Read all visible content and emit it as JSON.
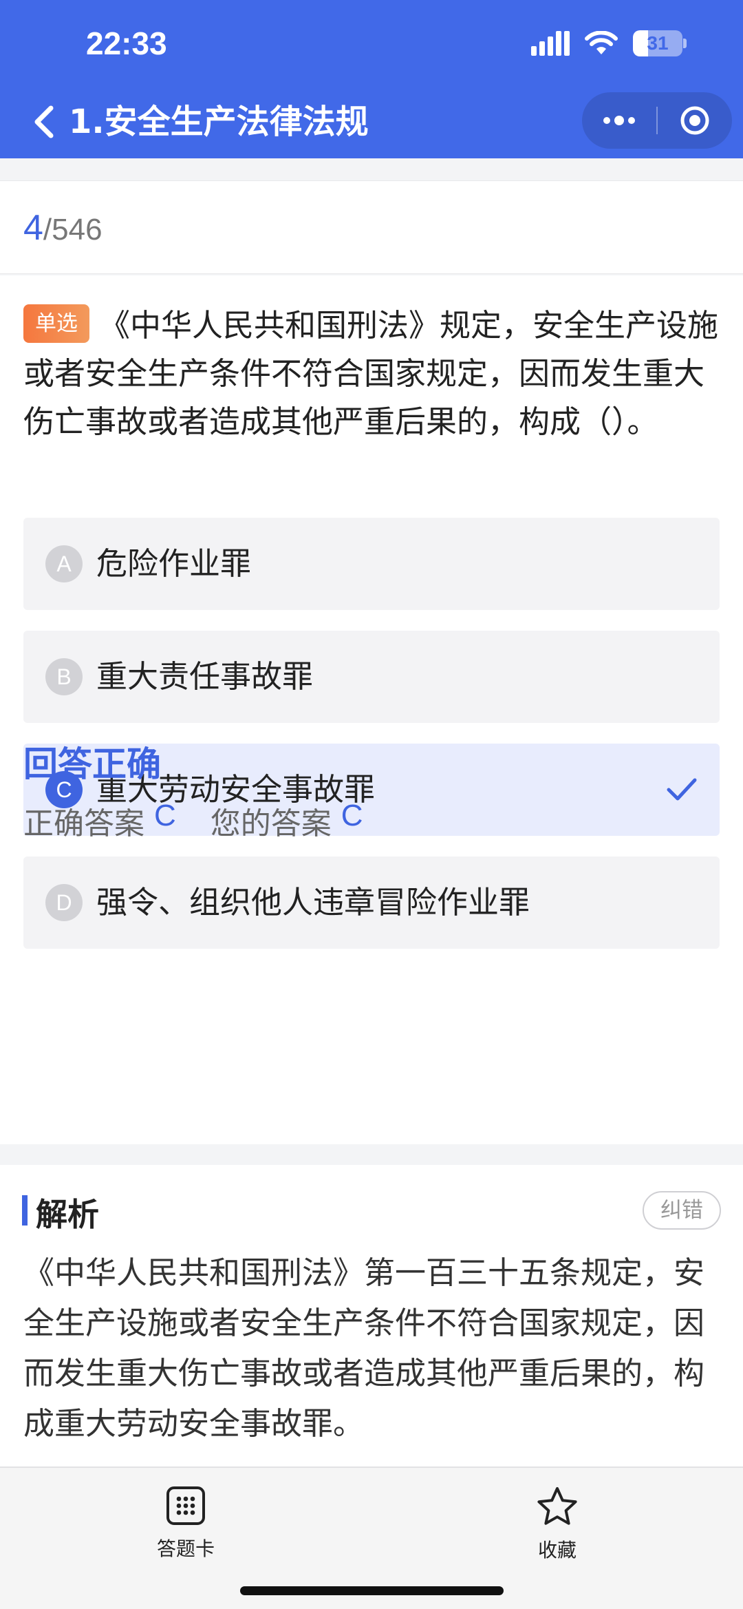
{
  "status_bar": {
    "time": "22:33",
    "battery": "31",
    "battery_level": 0.31
  },
  "nav": {
    "title": "1.安全生产法律法规",
    "back_icon": "chevron-left-icon",
    "more_icon": "more-dots-icon",
    "close_icon": "target-circle-icon"
  },
  "progress": {
    "current": "4",
    "total": "/546"
  },
  "question": {
    "type_badge": "单选",
    "text": "《中华人民共和国刑法》规定，安全生产设施或者安全生产条件不符合国家规定，因而发生重大伤亡事故或者造成其他严重后果的，构成（）。",
    "options": [
      {
        "letter": "A",
        "text": "危险作业罪",
        "selected": false
      },
      {
        "letter": "B",
        "text": "重大责任事故罪",
        "selected": false
      },
      {
        "letter": "C",
        "text": "重大劳动安全事故罪",
        "selected": true
      },
      {
        "letter": "D",
        "text": "强令、组织他人违章冒险作业罪",
        "selected": false
      }
    ]
  },
  "result": {
    "title": "回答正确",
    "correct_label": "正确答案",
    "correct_value": "C",
    "yours_label": "您的答案",
    "yours_value": "C"
  },
  "analysis": {
    "title": "解析",
    "report_label": "纠错",
    "text": "《中华人民共和国刑法》第一百三十五条规定，安全生产设施或者安全生产条件不符合国家规定，因而发生重大伤亡事故或者造成其他严重后果的，构成重大劳动安全事故罪。"
  },
  "tab_bar": {
    "answer_card_label": "答题卡",
    "answer_card_icon": "grid-keypad-icon",
    "favorite_label": "收藏",
    "favorite_icon": "star-icon"
  },
  "colors": {
    "header_blue": "#4169e8",
    "accent_blue": "#3f64e0",
    "badge_orange": "#f5773e",
    "selected_bg": "#e8ecfd"
  }
}
